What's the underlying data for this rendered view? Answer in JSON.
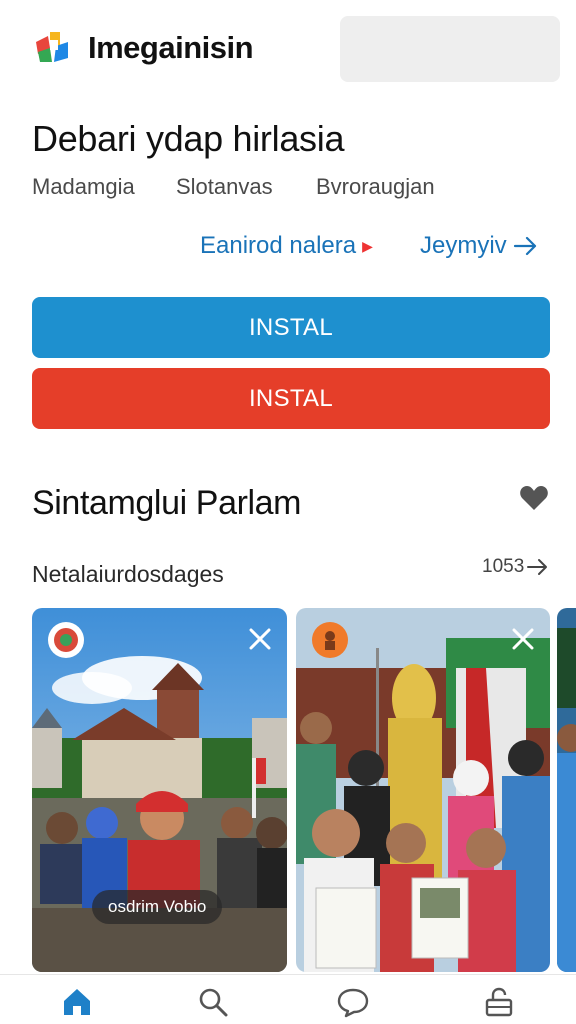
{
  "header": {
    "app_name": "Imegainisin",
    "logo_icon": "multicolor-app-logo"
  },
  "listing": {
    "title": "Debari ydap hirlasia",
    "meta": [
      "Madamgia",
      "Slotanvas",
      "Bvroraugjan"
    ],
    "links": [
      {
        "label": "Eanirod nalera",
        "icon": "arrow-right-icon"
      },
      {
        "label": "Jeymyiv",
        "icon": "arrow-right-icon"
      }
    ],
    "buttons": [
      {
        "label": "INSTAL",
        "color": "#1e90cf"
      },
      {
        "label": "INSTAL",
        "color": "#e53e29"
      }
    ]
  },
  "section": {
    "title": "Sintamglui Parlam",
    "heart_icon": "heart-icon",
    "subtitle": "Netalaiurdosdages",
    "count": "1053"
  },
  "cards": [
    {
      "video_label": "osdrim Vobio",
      "badge_icon": "app-badge-icon",
      "close_icon": "close-icon"
    },
    {
      "badge_icon": "app-badge-icon",
      "close_icon": "close-icon"
    },
    {}
  ],
  "nav": [
    {
      "icon": "home-icon",
      "active": true
    },
    {
      "icon": "search-icon"
    },
    {
      "icon": "chat-icon"
    },
    {
      "icon": "lock-icon"
    }
  ],
  "colors": {
    "accent_blue": "#1e90cf",
    "accent_red": "#e53e29",
    "link_blue": "#1a73b8"
  }
}
